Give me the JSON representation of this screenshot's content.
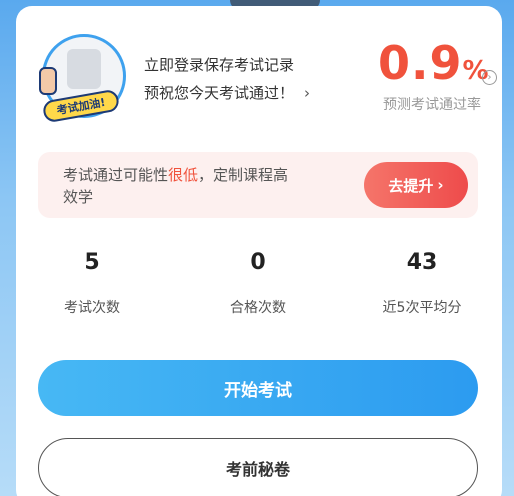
{
  "header": {
    "avatar_badge": "考试加油!",
    "login_title": "立即登录保存考试记录",
    "login_subtitle": "预祝您今天考试通过！",
    "subtitle_chevron": "›",
    "pass_rate_value": "0.9",
    "pass_rate_unit": "%",
    "pass_rate_info_icon": "›",
    "pass_rate_label": "预测考试通过率"
  },
  "promo": {
    "text_before": "考试通过可能性",
    "text_highlight": "很低",
    "text_after": "，定制课程高效学",
    "button_label": "去提升",
    "button_chevron": "›"
  },
  "stats": [
    {
      "value": "5",
      "label": "考试次数"
    },
    {
      "value": "0",
      "label": "合格次数"
    },
    {
      "value": "43",
      "label": "近5次平均分"
    }
  ],
  "actions": {
    "start_exam": "开始考试",
    "secret_paper": "考前秘卷"
  },
  "colors": {
    "accent_red": "#f0523c",
    "accent_blue": "#2c9bf0"
  }
}
